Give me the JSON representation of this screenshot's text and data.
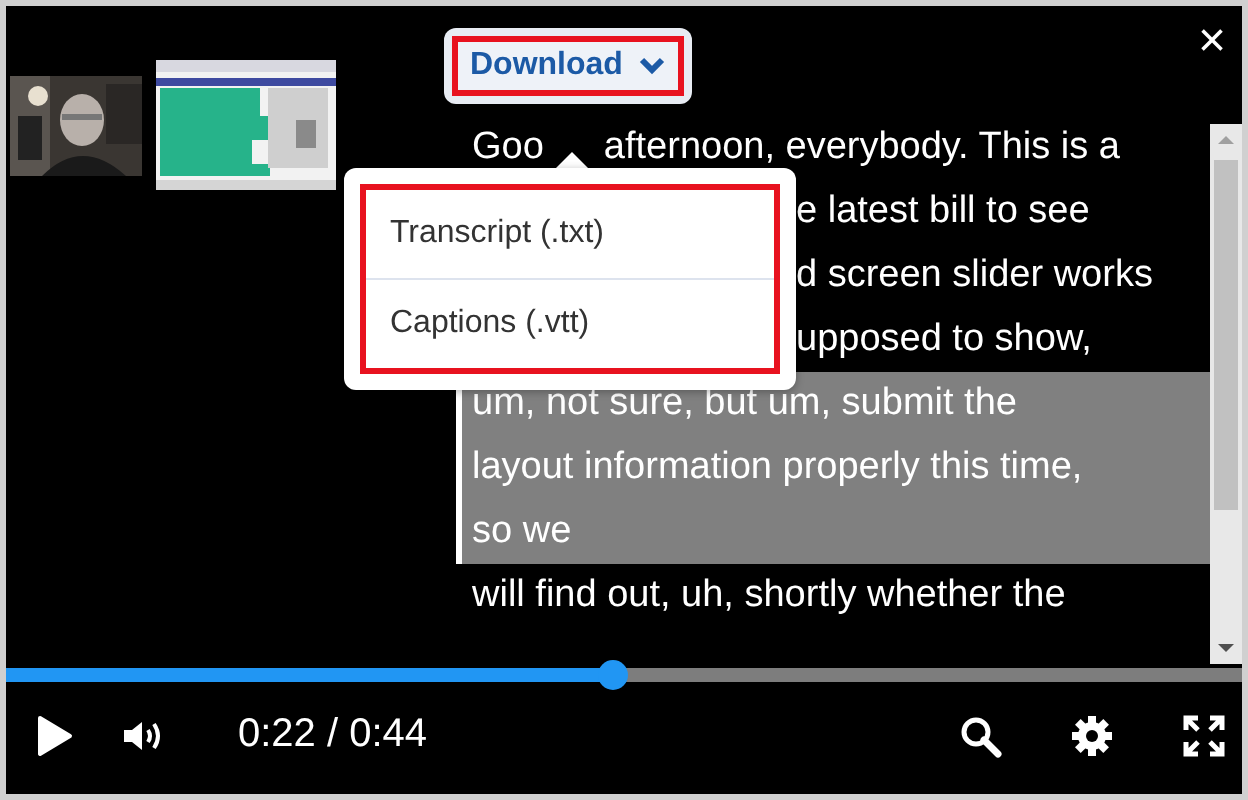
{
  "download": {
    "label": "Download",
    "expanded": true
  },
  "download_menu": {
    "items": [
      {
        "label": "Transcript (.txt)"
      },
      {
        "label": "Captions (.vtt)"
      }
    ]
  },
  "close": "×",
  "transcript": {
    "cues": [
      {
        "selected": false,
        "lines": [
          {
            "kind": "split",
            "text": "Goo",
            "rest": "afternoon, everybody. This is a"
          },
          {
            "kind": "partial",
            "text": "e latest bill to see"
          },
          {
            "kind": "partial",
            "text": "d screen slider works"
          },
          {
            "kind": "partial",
            "text": "upposed to show,"
          }
        ]
      },
      {
        "selected": true,
        "lines": [
          {
            "kind": "full",
            "text": "um, not sure, but um, submit the"
          },
          {
            "kind": "full",
            "text": "layout information properly this time,"
          },
          {
            "kind": "full",
            "text": "so we"
          }
        ]
      },
      {
        "selected": false,
        "lines": [
          {
            "kind": "full",
            "text": "will find out, uh, shortly whether the"
          }
        ]
      }
    ]
  },
  "progress": {
    "level": 0.49
  },
  "time": "0:22 / 0:44"
}
